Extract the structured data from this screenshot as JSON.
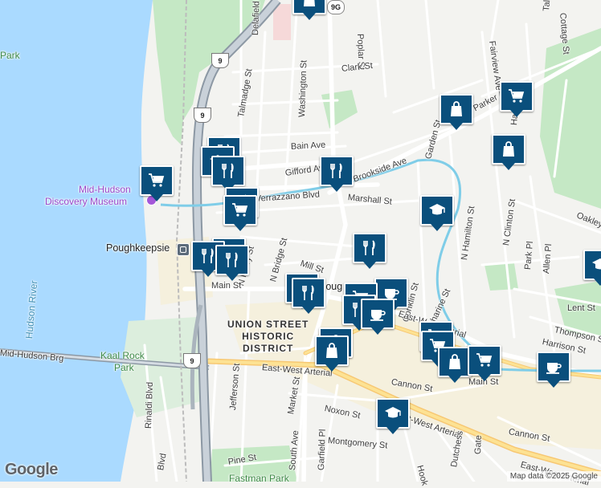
{
  "attribution": "Map data ©2025 Google",
  "logo": "Google",
  "colors": {
    "water": "#aadaff",
    "park": "#c5e8c5",
    "land": "#f3f3f0",
    "road": "#ffffff",
    "highway": "#9aa2ad",
    "pin": "#0a4f7c",
    "stream": "#7fcde8"
  },
  "streets": [
    {
      "text": "Delafield St"
    },
    {
      "text": "Poplar St"
    },
    {
      "text": "Clark St"
    },
    {
      "text": "Washington St"
    },
    {
      "text": "Talmadge St"
    },
    {
      "text": "Bain Ave"
    },
    {
      "text": "Gifford Ave"
    },
    {
      "text": "Brookside Ave"
    },
    {
      "text": "Verrazzano Blvd"
    },
    {
      "text": "Marshall St"
    },
    {
      "text": "Garden St"
    },
    {
      "text": "Fairview Ave"
    },
    {
      "text": "Parker Ave"
    },
    {
      "text": "Oakley St"
    },
    {
      "text": "Mill St"
    },
    {
      "text": "N Perry St"
    },
    {
      "text": "N Bridge St"
    },
    {
      "text": "Main St"
    },
    {
      "text": "Conklin St"
    },
    {
      "text": "Catharine St"
    },
    {
      "text": "N Hamilton St"
    },
    {
      "text": "N Clinton St"
    },
    {
      "text": "Park Pl"
    },
    {
      "text": "Allen Pl"
    },
    {
      "text": "Lent St"
    },
    {
      "text": "Thompson St"
    },
    {
      "text": "Harrison St"
    },
    {
      "text": "Mid-Hudson Brg"
    },
    {
      "text": "East-West Arterial"
    },
    {
      "text": "East-West Arterial"
    },
    {
      "text": "East-West Arterial"
    },
    {
      "text": "East-West Arterial"
    },
    {
      "text": "Cannon St"
    },
    {
      "text": "Cannon St"
    },
    {
      "text": "Noxon St"
    },
    {
      "text": "Jefferson St"
    },
    {
      "text": "Rinaldi Blvd"
    },
    {
      "text": "Market St"
    },
    {
      "text": "Montgomery St"
    },
    {
      "text": "Pine St"
    },
    {
      "text": "South Ave"
    },
    {
      "text": "Garfield Pl"
    },
    {
      "text": "Blvd"
    },
    {
      "text": "Hook"
    },
    {
      "text": "Dutchess"
    },
    {
      "text": "Gate"
    },
    {
      "text": "Tally Rd"
    },
    {
      "text": "Hamilton"
    },
    {
      "text": "Cottage St"
    },
    {
      "text": "Main St"
    }
  ],
  "places": [
    {
      "text": "Mid-Hudson",
      "kind": "poi"
    },
    {
      "text": "Discovery Museum",
      "kind": "poi"
    },
    {
      "text": "Poughkeepsie",
      "kind": "city"
    },
    {
      "text": "Poug",
      "kind": "city"
    },
    {
      "text": "Hudson River",
      "kind": "water"
    },
    {
      "text": "Kaal Rock",
      "kind": "park"
    },
    {
      "text": "Park",
      "kind": "park"
    },
    {
      "text": "Fastman Park",
      "kind": "park"
    },
    {
      "text": "Park",
      "kind": "park"
    }
  ],
  "district": {
    "line1": "UNION STREET",
    "line2": "HISTORIC",
    "line3": "DISTRICT"
  },
  "highways": [
    {
      "text": "9G"
    },
    {
      "text": "9"
    },
    {
      "text": "9"
    },
    {
      "text": "9"
    }
  ],
  "markers": [
    {
      "type": "shopping-bag"
    },
    {
      "type": "shopping-cart"
    },
    {
      "type": "shopping-bag"
    },
    {
      "type": "restaurant"
    },
    {
      "type": "restaurant"
    },
    {
      "type": "school"
    },
    {
      "type": "shopping-cart"
    },
    {
      "type": "restaurant"
    },
    {
      "type": "shopping-cart"
    },
    {
      "type": "restaurant"
    },
    {
      "type": "restaurant"
    },
    {
      "type": "school"
    },
    {
      "type": "restaurant"
    },
    {
      "type": "restaurant"
    },
    {
      "type": "restaurant"
    },
    {
      "type": "restaurant"
    },
    {
      "type": "cafe"
    },
    {
      "type": "shopping-cart"
    },
    {
      "type": "cafe"
    },
    {
      "type": "shopping-bag"
    },
    {
      "type": "shopping-cart"
    },
    {
      "type": "shopping-bag"
    },
    {
      "type": "shopping-cart"
    },
    {
      "type": "cafe"
    },
    {
      "type": "school"
    },
    {
      "type": "school"
    },
    {
      "type": "shopping-bag"
    }
  ]
}
